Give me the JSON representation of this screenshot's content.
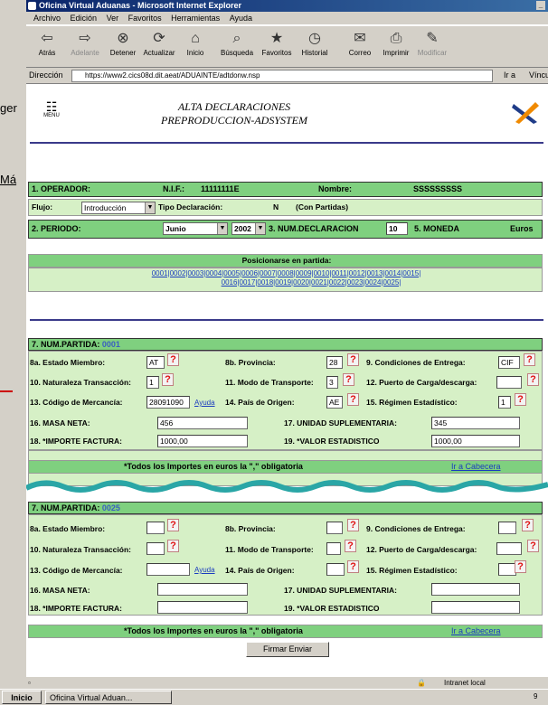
{
  "window": {
    "title": "Oficina Virtual Aduanas - Microsoft Internet Explorer"
  },
  "left_strip": {
    "text1": "ger",
    "text2": "Má"
  },
  "menu": [
    "Archivo",
    "Edición",
    "Ver",
    "Favoritos",
    "Herramientas",
    "Ayuda"
  ],
  "toolbar": [
    "Atrás",
    "Adelante",
    "Detener",
    "Actualizar",
    "Inicio",
    "Búsqueda",
    "Favoritos",
    "Historial",
    "Correo",
    "Imprimir",
    "Modificar"
  ],
  "address": {
    "label": "Dirección",
    "url": "https://www2.cics08d.dit.aeat/ADUAINTE/adtdonw.nsp",
    "go": "Ir a",
    "links": "Vínculo"
  },
  "header": {
    "menu_label": "MENU",
    "title_line1": "ALTA DECLARACIONES",
    "title_line2": "PREPRODUCCION-ADSYSTEM"
  },
  "operador": {
    "label": "1. OPERADOR:",
    "nif_label": "N.I.F.:",
    "nif": "11111111E",
    "nombre_label": "Nombre:",
    "nombre": "SSSSSSSSS"
  },
  "flujo": {
    "label": "Flujo:",
    "value": "Introducción",
    "tipo_label": "Tipo Declaración:",
    "tipo_code": "N",
    "tipo_desc": "(Con Partidas)"
  },
  "periodo": {
    "label": "2. PERIODO:",
    "mes": "Junio",
    "anio": "2002",
    "num_label": "3. NUM.DECLARACION",
    "num": "10",
    "moneda_label": "5. MONEDA",
    "moneda": "Euros"
  },
  "posicionarse": {
    "label": "Posicionarse en partida:",
    "line1": "0001|0002|0003|0004|0005|0006|0007|0008|0009|0010|0011|0012|0013|0014|0015|",
    "line2": "0016|0017|0018|0019|0020|0021|0022|0023|0024|0025|"
  },
  "labels": {
    "estado": "8a. Estado Miembro:",
    "provincia": "8b. Provincia:",
    "condiciones": "9. Condiciones de Entrega:",
    "naturaleza": "10. Naturaleza Transacción:",
    "modo": "11. Modo de Transporte:",
    "puerto": "12. Puerto de Carga/descarga:",
    "codigo": "13. Código de Mercancía:",
    "ayuda": "Ayuda",
    "pais": "14. País de Origen:",
    "regimen": "15. Régimen Estadístico:",
    "masa": "16. MASA NETA:",
    "unidad": "17. UNIDAD SUPLEMENTARIA:",
    "importe": "18. *IMPORTE FACTURA:",
    "valor": "19. *VALOR ESTADISTICO",
    "importes_note": "*Todos los Importes en euros la \",\" obligatoria",
    "ir_cabecera": "Ir a Cabecera",
    "q": "?"
  },
  "partida1": {
    "label": "7. NUM.PARTIDA:",
    "num": "0001",
    "estado": "AT",
    "provincia": "28",
    "condiciones": "CIF",
    "naturaleza": "1",
    "modo": "3",
    "puerto": "",
    "codigo": "28091090",
    "pais": "AE",
    "regimen": "1",
    "masa": "456",
    "unidad": "345",
    "importe": "1000,00",
    "valor": "1000,00"
  },
  "partida2": {
    "label": "7. NUM.PARTIDA:",
    "num": "0025"
  },
  "firmar": "Firmar Enviar",
  "status": {
    "zone": "Intranet local"
  },
  "taskbar": {
    "start": "Inicio",
    "task": "Oficina Virtual Aduan...",
    "clock": "9"
  }
}
